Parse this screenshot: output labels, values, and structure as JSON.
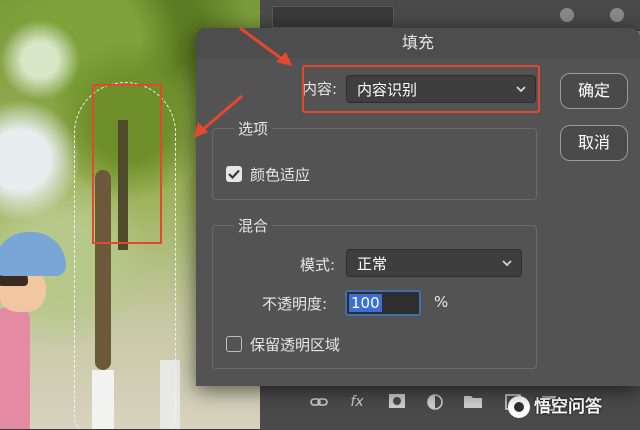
{
  "dialog": {
    "title": "填充",
    "content_label": "内容:",
    "content_value": "内容识别",
    "ok_label": "确定",
    "cancel_label": "取消"
  },
  "options": {
    "title": "选项",
    "color_adapt_label": "颜色适应",
    "color_adapt_checked": true
  },
  "blend": {
    "title": "混合",
    "mode_label": "模式:",
    "mode_value": "正常",
    "opacity_label": "不透明度:",
    "opacity_value": "100",
    "opacity_unit": "%",
    "preserve_label": "保留透明区域",
    "preserve_checked": false
  },
  "icons": {
    "chevron": "chevron-down-icon",
    "check": "checkmark-icon",
    "annotation_arrow": "red-arrow-icon",
    "layer_panel": [
      "link-icon",
      "fx-icon",
      "mask-icon",
      "adjustment-icon",
      "folder-icon",
      "new-layer-icon",
      "trash-icon"
    ]
  },
  "watermark": {
    "text": "悟空问答"
  },
  "colors": {
    "annotation_red": "#e4482f",
    "dialog_bg": "#535353",
    "selection_blue": "#3c6fd1"
  }
}
